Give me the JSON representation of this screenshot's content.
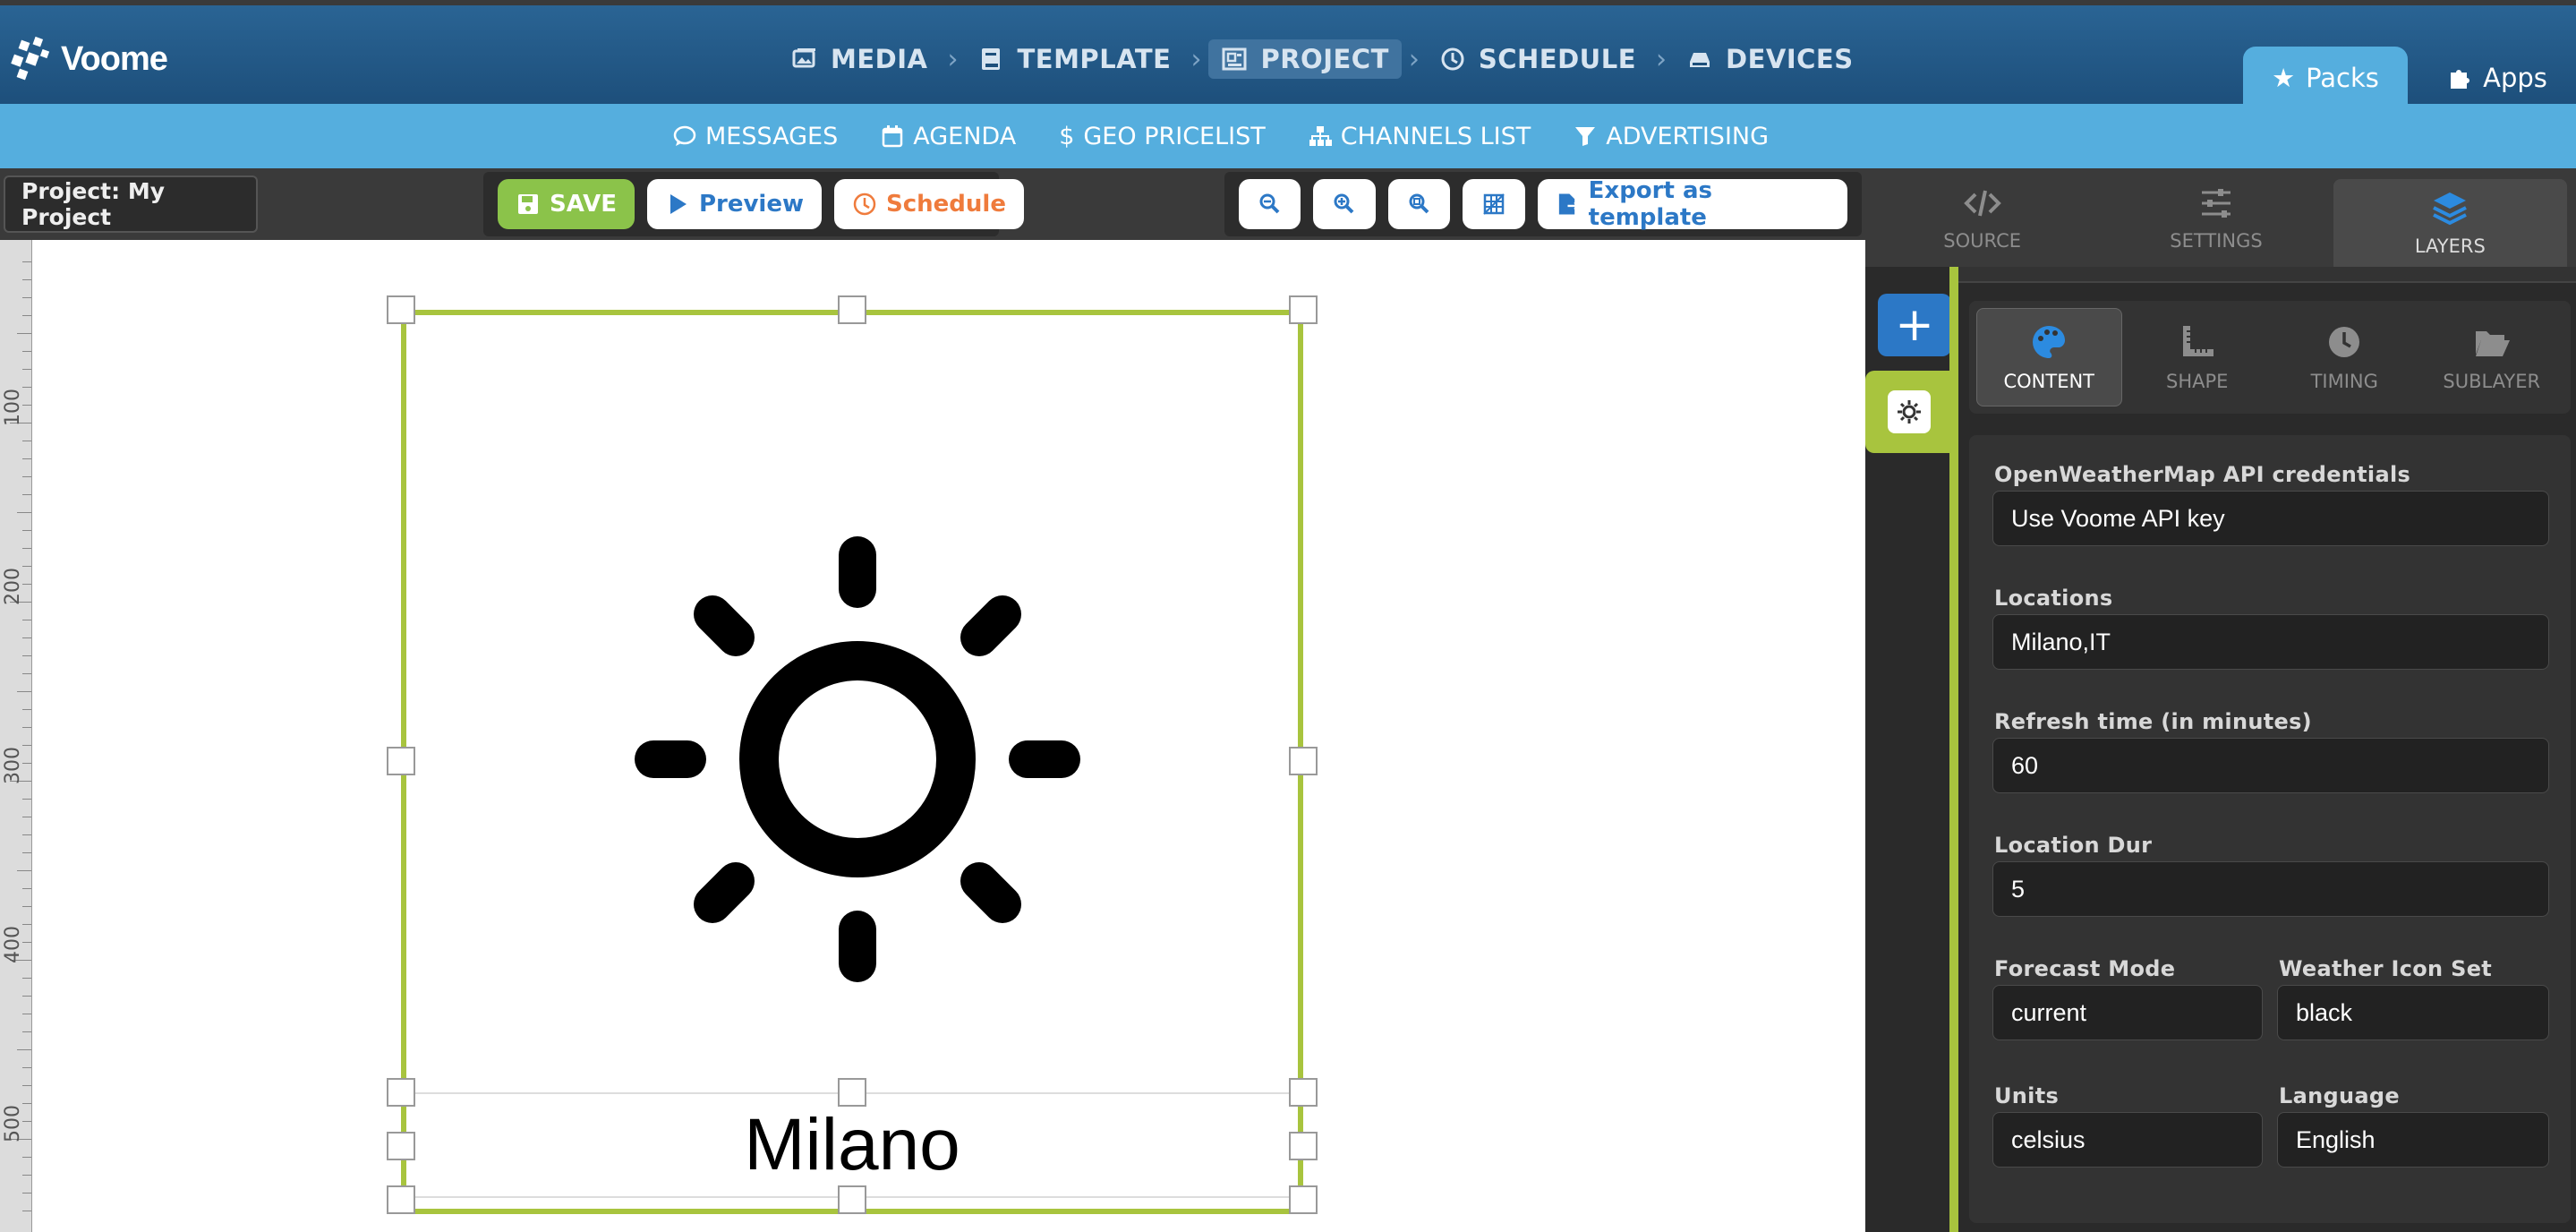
{
  "brand": {
    "name": "Voome"
  },
  "main_nav": [
    {
      "label": "MEDIA",
      "icon": "image-icon"
    },
    {
      "label": "TEMPLATE",
      "icon": "book-icon"
    },
    {
      "label": "PROJECT",
      "icon": "project-icon",
      "active": true
    },
    {
      "label": "SCHEDULE",
      "icon": "clock-icon"
    },
    {
      "label": "DEVICES",
      "icon": "drive-icon"
    }
  ],
  "top_right": {
    "packs": "Packs",
    "apps": "Apps"
  },
  "sub_nav": [
    {
      "label": "MESSAGES",
      "icon": "comment-icon"
    },
    {
      "label": "AGENDA",
      "icon": "calendar-icon"
    },
    {
      "label": "GEO PRICELIST",
      "icon": "dollar-icon"
    },
    {
      "label": "CHANNELS LIST",
      "icon": "sitemap-icon"
    },
    {
      "label": "ADVERTISING",
      "icon": "funnel-icon"
    }
  ],
  "toolbar": {
    "project_name": "Project: My Project",
    "save": "SAVE",
    "preview": "Preview",
    "schedule": "Schedule",
    "export": "Export as template"
  },
  "ruler": {
    "labels": [
      "100",
      "200",
      "300",
      "400",
      "500"
    ]
  },
  "canvas": {
    "city": "Milano"
  },
  "right_tabs": [
    {
      "label": "SOURCE",
      "icon": "code-icon"
    },
    {
      "label": "SETTINGS",
      "icon": "sliders-icon"
    },
    {
      "label": "LAYERS",
      "icon": "layers-icon",
      "active": true
    }
  ],
  "layer_tabs": [
    {
      "label": "CONTENT",
      "icon": "palette-icon",
      "active": true
    },
    {
      "label": "SHAPE",
      "icon": "ruler-icon"
    },
    {
      "label": "TIMING",
      "icon": "clock-icon"
    },
    {
      "label": "SUBLAYER",
      "icon": "folder-icon"
    }
  ],
  "form": {
    "api_label": "OpenWeatherMap API credentials",
    "api_value": "Use Voome API key",
    "locations_label": "Locations",
    "locations_value": "Milano,IT",
    "refresh_label": "Refresh time (in minutes)",
    "refresh_value": "60",
    "location_dur_label": "Location Dur",
    "location_dur_value": "5",
    "forecast_label": "Forecast Mode",
    "forecast_value": "current",
    "iconset_label": "Weather Icon Set",
    "iconset_value": "black",
    "units_label": "Units",
    "units_value": "celsius",
    "language_label": "Language",
    "language_value": "English"
  },
  "colors": {
    "topbar": "#2a6494",
    "subbar": "#55aede",
    "accent_green": "#a8c43e",
    "save_green": "#8bc34a",
    "blue": "#2c78c6",
    "orange": "#ef7b3c"
  }
}
